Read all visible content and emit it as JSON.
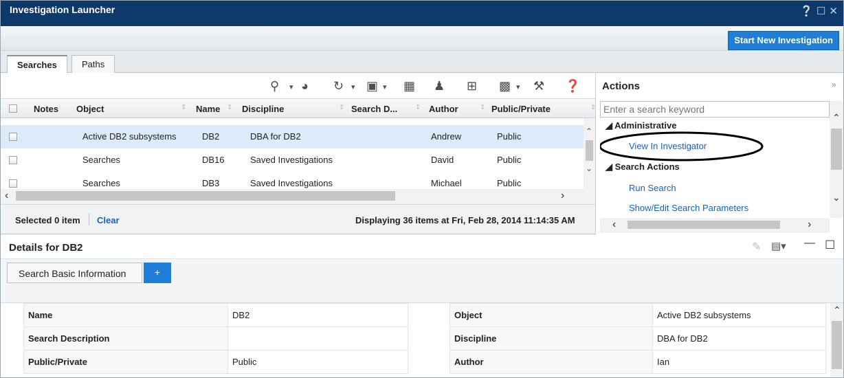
{
  "window": {
    "title": "Investigation Launcher",
    "controls": [
      "help-icon",
      "maximize-icon",
      "close-icon"
    ]
  },
  "header": {
    "start_button": "Start New Investigation"
  },
  "tabs": [
    {
      "label": "Searches",
      "selected": true
    },
    {
      "label": "Paths",
      "selected": false
    }
  ],
  "grid": {
    "columns": [
      "Notes",
      "Object",
      "Name",
      "Discipline",
      "Search D...",
      "Author",
      "Public/Private"
    ],
    "rows": [
      {
        "object": "Active DB2 subsystems",
        "name": "DB2",
        "discipline": "DBA for DB2",
        "author": "Andrew",
        "visibility": "Public",
        "selected": true
      },
      {
        "object": "Searches",
        "name": "DB16",
        "discipline": "Saved Investigations",
        "author": "David",
        "visibility": "Public"
      },
      {
        "object": "Searches",
        "name": "DB3",
        "discipline": "Saved Investigations",
        "author": "Michael",
        "visibility": "Public"
      }
    ],
    "toolbar_icons": [
      "search-icon",
      "globe-icon",
      "refresh-icon",
      "save-icon",
      "filter-icon",
      "user-icon",
      "add-icon",
      "export-icon",
      "wrench-icon",
      "help-icon"
    ]
  },
  "status": {
    "selected": "Selected 0 item",
    "clear": "Clear",
    "displaying": "Displaying 36 items at Fri, Feb 28, 2014 11:14:35 AM"
  },
  "actions": {
    "title": "Actions",
    "search_placeholder": "Enter a search keyword",
    "groups": [
      {
        "label": "Administrative",
        "items": [
          "View In Investigator"
        ]
      },
      {
        "label": "Search Actions",
        "items": [
          "Run Search",
          "Show/Edit Search Parameters"
        ]
      }
    ]
  },
  "details": {
    "title": "Details for DB2",
    "tab": "Search Basic Information",
    "add_tab": "+",
    "left": [
      {
        "k": "Name",
        "v": "DB2"
      },
      {
        "k": "Search Description",
        "v": ""
      },
      {
        "k": "Public/Private",
        "v": "Public"
      }
    ],
    "right": [
      {
        "k": "Object",
        "v": "Active DB2 subsystems"
      },
      {
        "k": "Discipline",
        "v": "DBA for DB2"
      },
      {
        "k": "Author",
        "v": "Ian"
      }
    ]
  },
  "colors": {
    "title_bar": "#0d3a6b",
    "accent": "#1e7ed8",
    "selected_row": "#dcebfa",
    "link": "#1a5fc0"
  }
}
